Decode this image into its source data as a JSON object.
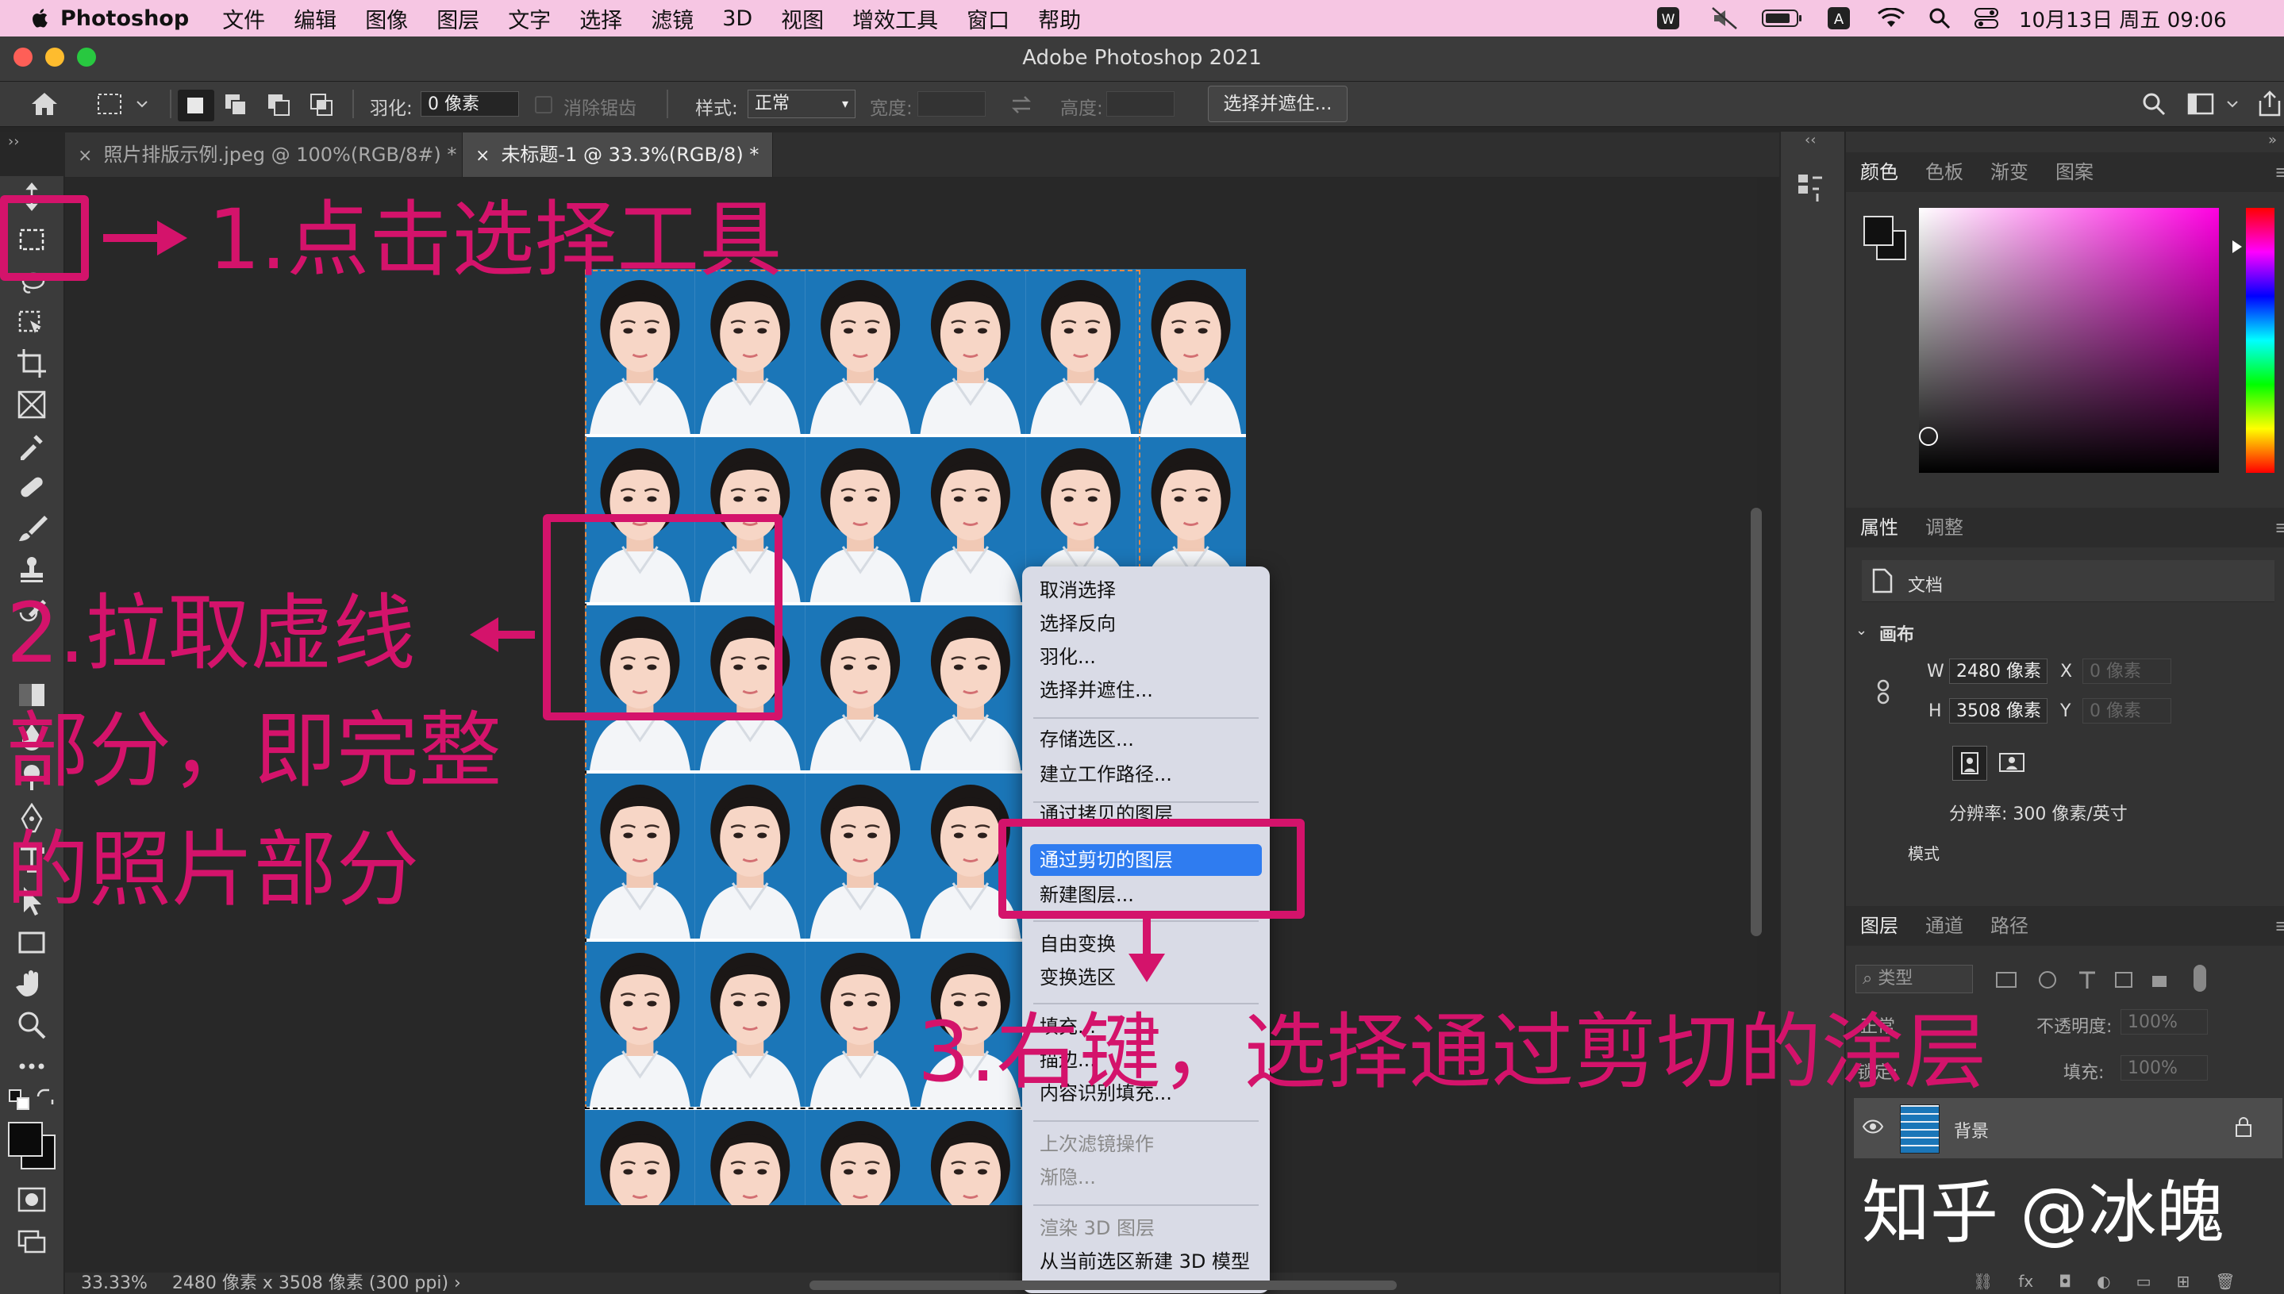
{
  "menubar": {
    "app": "Photoshop",
    "items": [
      "文件",
      "编辑",
      "图像",
      "图层",
      "文字",
      "选择",
      "滤镜",
      "3D",
      "视图",
      "增效工具",
      "窗口",
      "帮助"
    ],
    "clock": "10月13日 周五  09:06"
  },
  "window": {
    "title": "Adobe Photoshop 2021"
  },
  "options": {
    "feather_label": "羽化:",
    "feather_value": "0 像素",
    "antialias_label": "消除锯齿",
    "style_label": "样式:",
    "style_value": "正常",
    "width_label": "宽度:",
    "height_label": "高度:",
    "select_mask": "选择并遮住..."
  },
  "tabs": [
    {
      "label": "照片排版示例.jpeg @ 100%(RGB/8#) *"
    },
    {
      "label": "未标题-1 @ 33.3%(RGB/8) *"
    }
  ],
  "document": {
    "columns": 6,
    "rows": 6,
    "selection_columns": 5,
    "selection_rows": 5
  },
  "status": {
    "zoom": "33.33%",
    "info": "2480 像素 x 3508 像素 (300 ppi)  ›"
  },
  "context_menu": {
    "items": [
      {
        "label": "取消选择",
        "enabled": true
      },
      {
        "label": "选择反向",
        "enabled": true
      },
      {
        "label": "羽化...",
        "enabled": true
      },
      {
        "label": "选择并遮住...",
        "enabled": true
      },
      {
        "label": "存储选区...",
        "enabled": true
      },
      {
        "label": "建立工作路径...",
        "enabled": true
      },
      {
        "label": "通过拷贝的图层",
        "enabled": true
      },
      {
        "label": "通过剪切的图层",
        "enabled": true,
        "highlighted": true
      },
      {
        "label": "新建图层...",
        "enabled": true
      },
      {
        "label": "自由变换",
        "enabled": true
      },
      {
        "label": "变换选区",
        "enabled": true
      },
      {
        "label": "填充...",
        "enabled": true
      },
      {
        "label": "描边...",
        "enabled": true
      },
      {
        "label": "内容识别填充...",
        "enabled": true
      },
      {
        "label": "上次滤镜操作",
        "enabled": false
      },
      {
        "label": "渐隐...",
        "enabled": false
      },
      {
        "label": "渲染 3D 图层",
        "enabled": false
      },
      {
        "label": "从当前选区新建 3D 模型",
        "enabled": true
      }
    ]
  },
  "panels": {
    "color_tabs": [
      "颜色",
      "色板",
      "渐变",
      "图案"
    ],
    "props_tabs": [
      "属性",
      "调整"
    ],
    "doc_label": "文档",
    "canvas_label": "画布",
    "w_label": "W",
    "w_value": "2480 像素",
    "h_label": "H",
    "h_value": "3508 像素",
    "x_label": "X",
    "x_value": "0 像素",
    "y_label": "Y",
    "y_value": "0 像素",
    "resolution": "分辨率: 300 像素/英寸",
    "mode_label": "模式",
    "layers_tabs": [
      "图层",
      "通道",
      "路径"
    ],
    "layer_search": "类型",
    "opacity_label": "不透明度:",
    "opacity_value": "100%",
    "lock_label": "锁定:",
    "fill_label": "填充:",
    "fill_value": "100%",
    "layer_name": "背景"
  },
  "annotations": {
    "step1": "1.点击选择工具",
    "step2_l1": "2.拉取虚线",
    "step2_l2": "部分，即完整",
    "step2_l3": "的照片部分",
    "step3": "3.右键，选择通过剪切的涂层"
  },
  "watermark": "知乎 @冰魄",
  "colors": {
    "annotation": "#d4136b",
    "menubar": "#f6c6e3",
    "highlight": "#2f7cf0",
    "photo_bg": "#1b76b8"
  }
}
